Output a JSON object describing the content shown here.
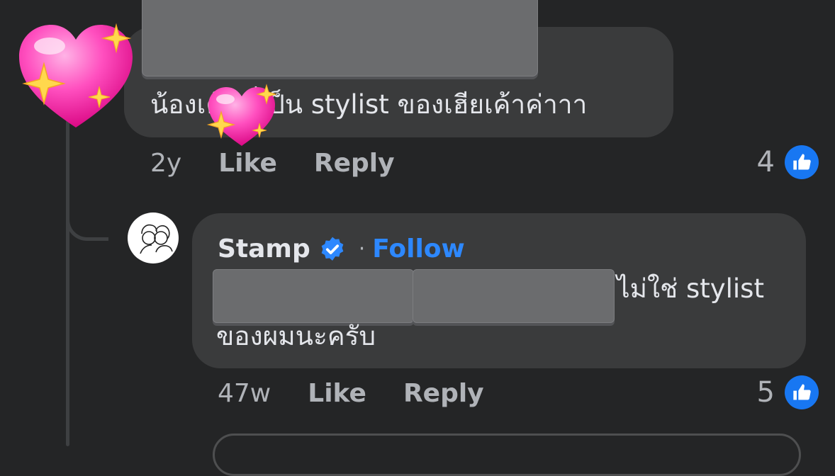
{
  "comments": [
    {
      "text": "น้องเค้า…่เป็น stylist ของเฮียเค้าค่าาา",
      "time": "2y",
      "like_label": "Like",
      "reply_label": "Reply",
      "reaction_count": "4"
    },
    {
      "author": "Stamp",
      "verified": true,
      "separator": "·",
      "follow_label": "Follow",
      "text_line1": "ไม่ใช่ stylist",
      "text_line2": "ของผมนะครับ",
      "time": "47w",
      "like_label": "Like",
      "reply_label": "Reply",
      "reaction_count": "5"
    }
  ],
  "icons": {
    "reaction": "thumbs-up-icon",
    "verified": "verified-badge-icon",
    "stickers": [
      "sparkling-heart-icon",
      "sparkling-heart-icon"
    ]
  },
  "colors": {
    "background": "#242526",
    "bubble": "#3a3b3c",
    "link": "#2d88ff",
    "like_badge": "#1877f2",
    "muted_text": "#b0b3b8",
    "text": "#e4e6eb"
  }
}
